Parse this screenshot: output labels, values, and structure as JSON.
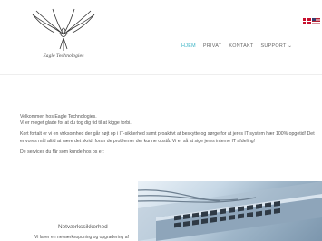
{
  "header": {
    "logo_text": "Eagle Technologies",
    "nav": [
      {
        "label": "HJEM"
      },
      {
        "label": "PRIVAT"
      },
      {
        "label": "KONTAKT"
      },
      {
        "label": "SUPPORT ⌄"
      }
    ],
    "flags": [
      "denmark-flag-icon",
      "usa-flag-icon"
    ]
  },
  "content": {
    "paragraphs": [
      "Velkommen hos Eagle Technologies.",
      "Vi er meget glade for at du tog dig tid til at kigge forbi.",
      "Kort fortalt er vi en virksomhed der går højt op i IT-sikkerhed samt proaktivt at beskytte og sørge for at jeres IT-system hær 100% opgetid! Det er vores mål altid at være det skridt foran de problemer der kunne opstå. Vi er så at sige jeres interne IT afdeling!",
      "De services du får som kunde hos os er:"
    ]
  },
  "service": {
    "title": "Netværkssikkerhed",
    "desc": "Vi laver en netværksopdning og opgradering af"
  },
  "colors": {
    "accent": "#36b2c4",
    "text": "#555555"
  }
}
